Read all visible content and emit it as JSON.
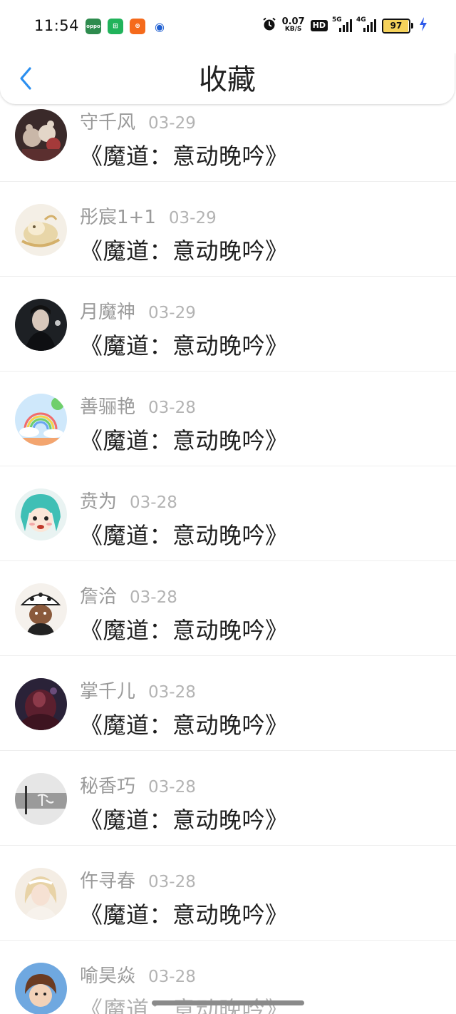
{
  "status_bar": {
    "time": "11:54",
    "net_speed_value": "0.07",
    "net_speed_unit": "KB/S",
    "hd_label": "HD",
    "signal_1_label": "5G",
    "signal_2_label": "4G",
    "battery_level": "97",
    "battery_fill_percent": 97,
    "battery_color": "#f5d25b",
    "charging_color": "#2f5bea",
    "app_icons": [
      {
        "name": "oppo-store-icon",
        "color": "#2e8b4e",
        "glyph": "oppo"
      },
      {
        "name": "market-icon",
        "color": "#21b35b",
        "glyph": "⊞"
      },
      {
        "name": "taobao-icon",
        "color": "#f56a1b",
        "glyph": "⊛"
      },
      {
        "name": "payment-icon",
        "color": "#1f5fd1",
        "glyph": "◉"
      }
    ]
  },
  "header": {
    "title": "收藏",
    "back_icon": "chevron-left-icon",
    "accent_color": "#2b8ff0"
  },
  "favorites": [
    {
      "username": "守千风",
      "date": "03-29",
      "title": "《魔道：意动晚吟》",
      "avatar": "plush-toys"
    },
    {
      "username": "彤宸1+1",
      "date": "03-29",
      "title": "《魔道：意动晚吟》",
      "avatar": "golden-dragon"
    },
    {
      "username": "月魔神",
      "date": "03-29",
      "title": "《魔道：意动晚吟》",
      "avatar": "dark-portrait"
    },
    {
      "username": "善骊艳",
      "date": "03-28",
      "title": "《魔道：意动晚吟》",
      "avatar": "rainbow-sky"
    },
    {
      "username": "贲为",
      "date": "03-28",
      "title": "《魔道：意动晚吟》",
      "avatar": "anime-teal-hair"
    },
    {
      "username": "詹洽",
      "date": "03-28",
      "title": "《魔道：意动晚吟》",
      "avatar": "cartoon-spotted-hat"
    },
    {
      "username": "掌千儿",
      "date": "03-28",
      "title": "《魔道：意动晚吟》",
      "avatar": "dark-red-art"
    },
    {
      "username": "秘香巧",
      "date": "03-28",
      "title": "《魔道：意动晚吟》",
      "avatar": "grey-calligraphy"
    },
    {
      "username": "仵寻春",
      "date": "03-28",
      "title": "《魔道：意动晚吟》",
      "avatar": "blonde-girl"
    },
    {
      "username": "喻昊焱",
      "date": "03-28",
      "title": "《魔道：意动晚吟》",
      "avatar": "cartoon-boy"
    }
  ]
}
